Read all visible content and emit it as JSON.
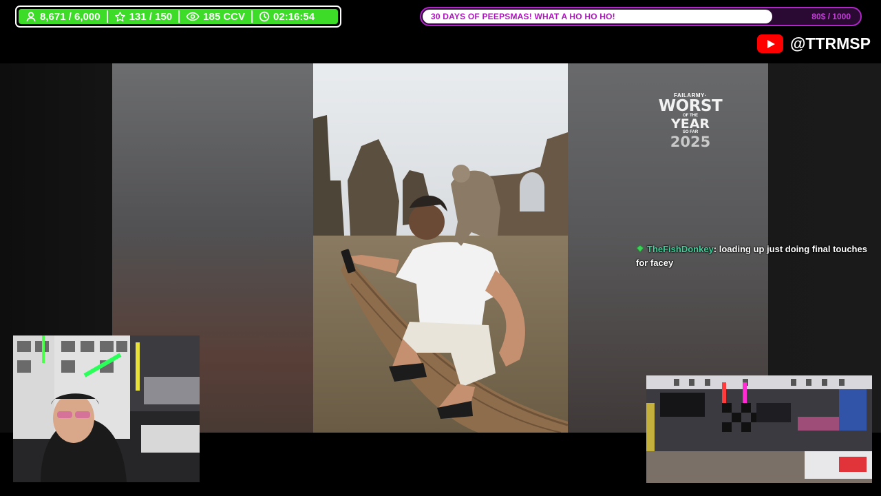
{
  "stats": {
    "followers": "8,671 / 6,000",
    "subs": "131 / 150",
    "viewers": "185 CCV",
    "uptime": "02:16:54"
  },
  "goal": {
    "title": "30 DAYS OF PEEPSMAS! WHAT A HO HO HO!",
    "count": "80$ / 1000"
  },
  "channel": {
    "handle": "@TTRMSP"
  },
  "overlay": {
    "brand": "FAILARMY·",
    "line1": "WORST",
    "line2": "OF THE",
    "line3": "YEAR",
    "line4": "SO FAR",
    "line5": "2025"
  },
  "chat": [
    {
      "user": "TheFishDonkey",
      "message": ": loading up just doing final touches for facey"
    }
  ],
  "colors": {
    "stats_green": "#3ddc28",
    "goal_purple": "#b026c8",
    "youtube_red": "#ff0000",
    "chat_user": "#3fcf9b"
  }
}
